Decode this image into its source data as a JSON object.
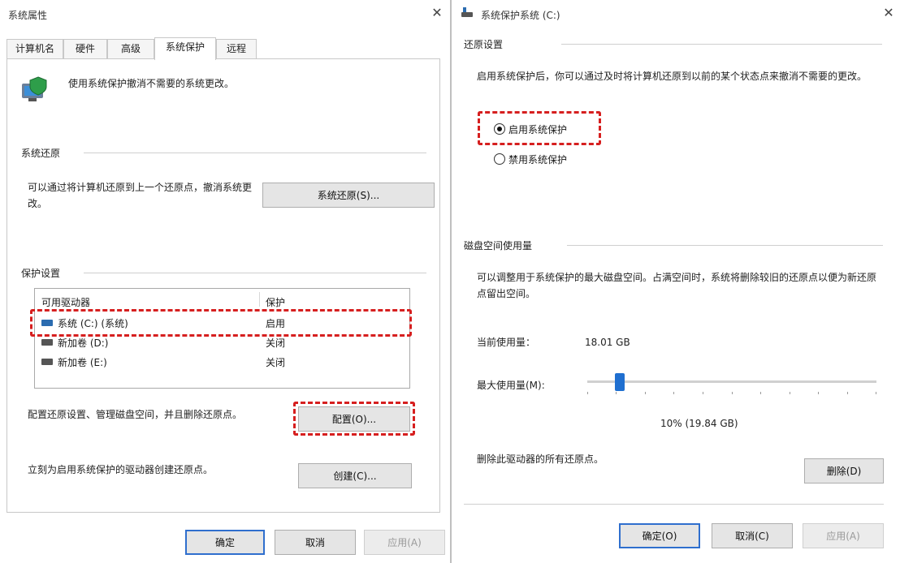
{
  "left_window": {
    "title": "系统属性",
    "tabs": [
      "计算机名",
      "硬件",
      "高级",
      "系统保护",
      "远程"
    ],
    "intro_text": "使用系统保护撤消不需要的系统更改。",
    "restore_group": {
      "label": "系统还原",
      "description": "可以通过将计算机还原到上一个还原点，撤消系统更改。",
      "button": "系统还原(S)..."
    },
    "protection_group": {
      "label": "保护设置",
      "columns": [
        "可用驱动器",
        "保护"
      ],
      "drives": [
        {
          "name": "系统 (C:) (系统)",
          "status": "启用"
        },
        {
          "name": "新加卷 (D:)",
          "status": "关闭"
        },
        {
          "name": "新加卷 (E:)",
          "status": "关闭"
        }
      ],
      "configure_text": "配置还原设置、管理磁盘空间，并且删除还原点。",
      "configure_button": "配置(O)...",
      "create_text": "立刻为启用系统保护的驱动器创建还原点。",
      "create_button": "创建(C)..."
    },
    "footer": {
      "ok": "确定",
      "cancel": "取消",
      "apply": "应用(A)"
    }
  },
  "right_window": {
    "title": "系统保护系统 (C:)",
    "restore_settings": {
      "label": "还原设置",
      "description": "启用系统保护后，你可以通过及时将计算机还原到以前的某个状态点来撤消不需要的更改。",
      "options": [
        {
          "label": "启用系统保护",
          "selected": true
        },
        {
          "label": "禁用系统保护",
          "selected": false
        }
      ]
    },
    "disk_usage": {
      "label": "磁盘空间使用量",
      "description": "可以调整用于系统保护的最大磁盘空间。占满空间时，系统将删除较旧的还原点以便为新还原点留出空间。",
      "current_label": "当前使用量：",
      "current_value": "18.01 GB",
      "max_label": "最大使用量(M):",
      "max_fraction": 0.1,
      "max_value_text": "10% (19.84 GB)",
      "delete_text": "删除此驱动器的所有还原点。",
      "delete_button": "删除(D)"
    },
    "footer": {
      "ok": "确定(O)",
      "cancel": "取消(C)",
      "apply": "应用(A)"
    }
  }
}
